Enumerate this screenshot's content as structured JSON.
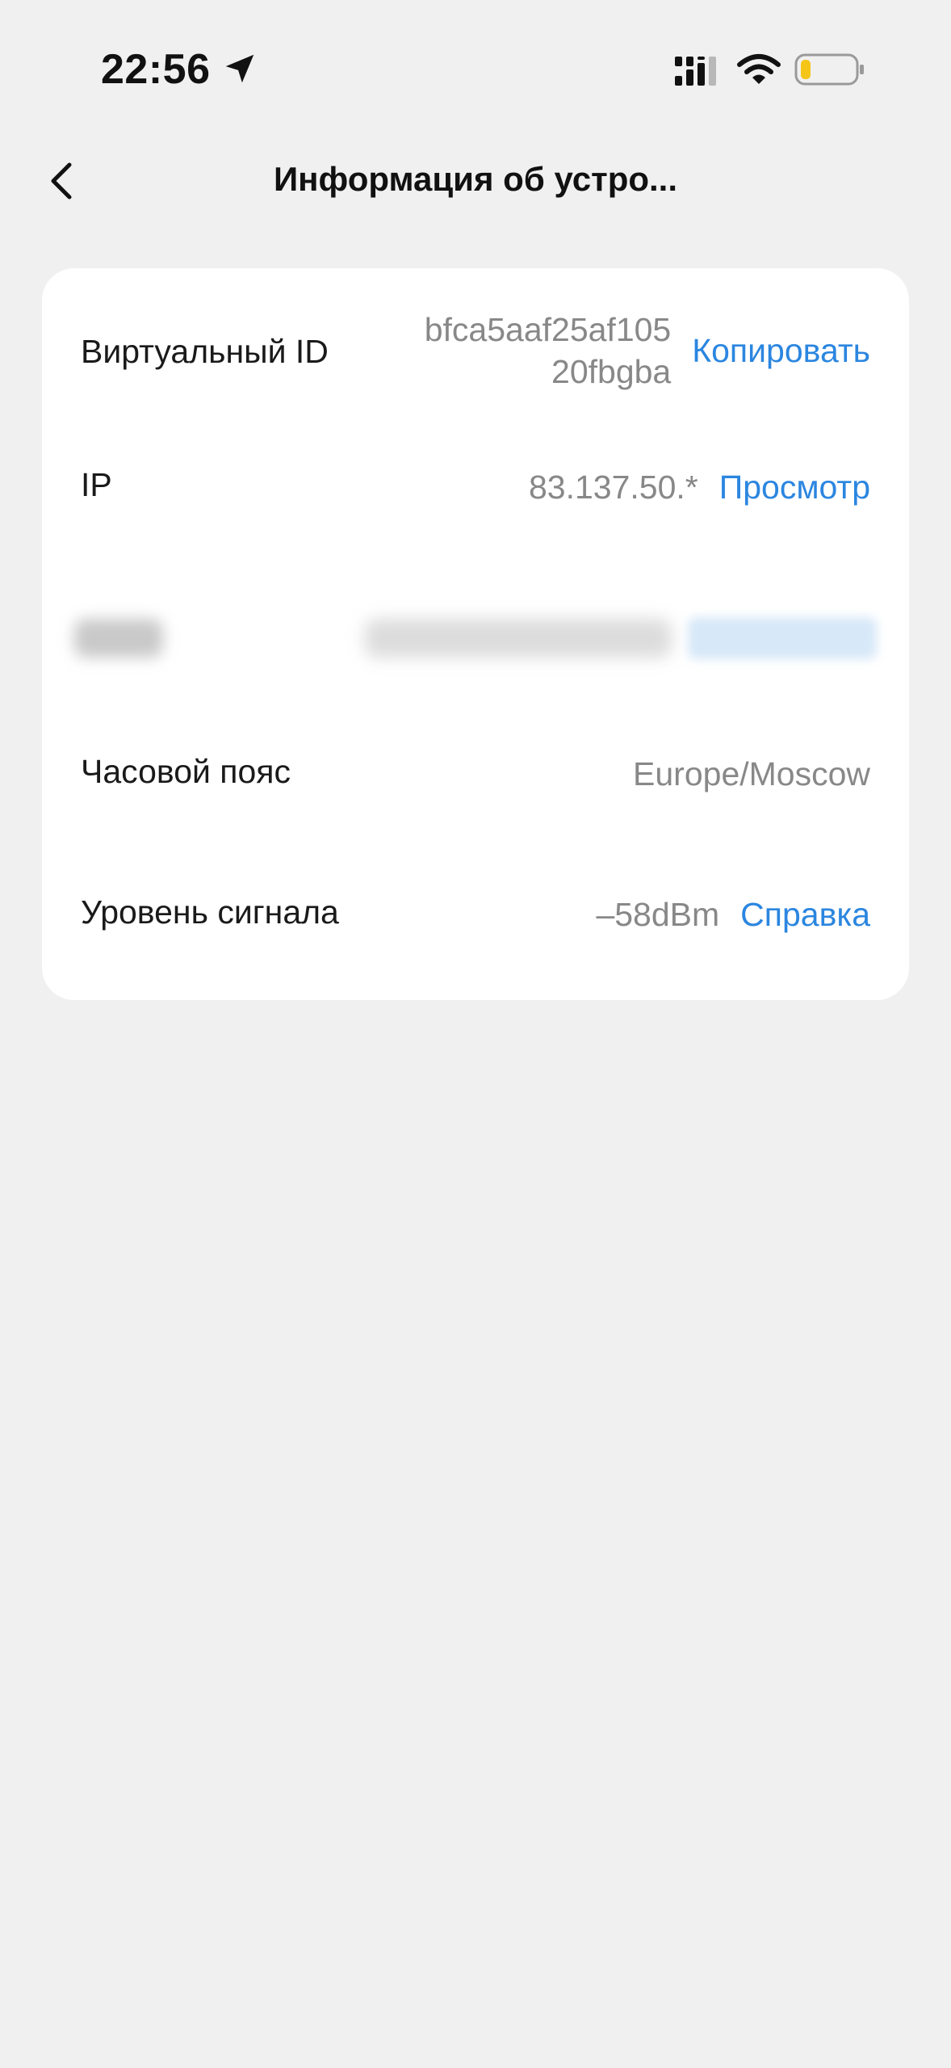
{
  "status_bar": {
    "time": "22:56",
    "icons": [
      "location-arrow-icon",
      "cellular-signal-icon",
      "wifi-icon",
      "battery-low-icon"
    ],
    "battery_color": "#f5c518"
  },
  "nav": {
    "back_icon": "chevron-left-icon",
    "title": "Информация об устро..."
  },
  "device_info": {
    "virtual_id": {
      "label": "Виртуальный ID",
      "value": "bfca5aaf25af105 20fbgba",
      "action": "Копировать"
    },
    "ip": {
      "label": "IP",
      "value": "83.137.50.*",
      "action": "Просмотр"
    },
    "timezone": {
      "label": "Часовой пояс",
      "value": "Europe/Moscow"
    },
    "signal": {
      "label": "Уровень сигнала",
      "value": "–58dBm",
      "action": "Справка"
    }
  },
  "colors": {
    "background": "#f0f0f0",
    "card": "#ffffff",
    "accent": "#2b86e0",
    "muted_text": "#888888"
  }
}
